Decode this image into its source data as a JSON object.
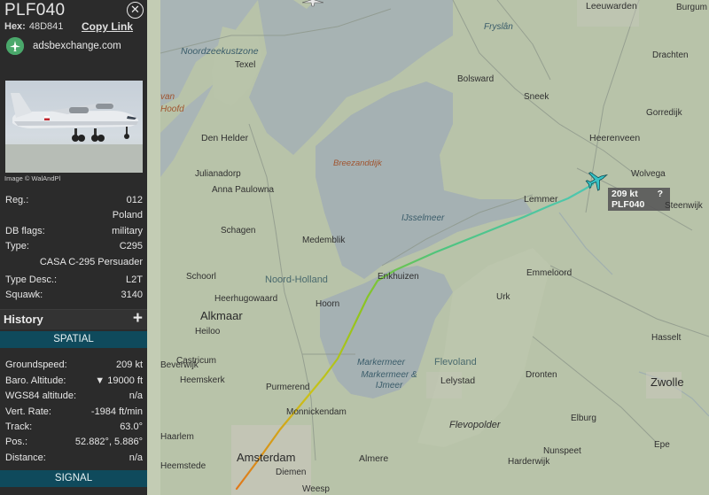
{
  "sidebar": {
    "callsign": "PLF040",
    "hex_label": "Hex:",
    "hex_value": "48D841",
    "copy_link": "Copy Link",
    "adsb_site": "adsbexchange.com",
    "photo_credit": "Image © WalAndPl",
    "info": [
      {
        "label": "Reg.:",
        "value": "012"
      },
      {
        "label": "",
        "value": "Poland"
      },
      {
        "label": "DB flags:",
        "value": "military"
      },
      {
        "label": "Type:",
        "value": "C295"
      },
      {
        "label": "",
        "value": "CASA C-295 Persuader"
      },
      {
        "label": "Type Desc.:",
        "value": "L2T"
      },
      {
        "label": "Squawk:",
        "value": "3140"
      }
    ],
    "history_title": "History",
    "history_plus": "+",
    "spatial_title": "SPATIAL",
    "spatial": [
      {
        "label": "Groundspeed:",
        "value": "209 kt"
      },
      {
        "label": "Baro. Altitude:",
        "value": "▼ 19000 ft"
      },
      {
        "label": "WGS84 altitude:",
        "value": "n/a"
      },
      {
        "label": "Vert. Rate:",
        "value": "-1984 ft/min"
      },
      {
        "label": "Track:",
        "value": "63.0°"
      },
      {
        "label": "Pos.:",
        "value": "52.882°, 5.886°"
      },
      {
        "label": "Distance:",
        "value": "n/a"
      }
    ],
    "signal_title": "SIGNAL"
  },
  "map": {
    "aircraft_speed": "209 kt",
    "aircraft_unknown": "?",
    "aircraft_callsign": "PLF040",
    "labels": {
      "leeuwarden": "Leeuwarden",
      "burgum": "Burgum",
      "fryslan": "Fryslân",
      "noordzeekustzone": "Noordzeekustzone",
      "texel": "Texel",
      "bolsward": "Bolsward",
      "drachten": "Drachten",
      "den_helder": "Den Helder",
      "sneek": "Sneek",
      "gorredijk": "Gorredijk",
      "heerenveen": "Heerenveen",
      "breezanddijk": "Breezanddijk",
      "wolvega": "Wolvega",
      "julianadorp": "Julianadorp",
      "anna_paulowna": "Anna Paulowna",
      "lemmer": "Lemmer",
      "steenwijk": "Steenwijk",
      "ijsselmeer": "IJsselmeer",
      "schagen": "Schagen",
      "medemblik": "Medemblik",
      "emmeloord": "Emmeloord",
      "schoorl": "Schoorl",
      "noord_holland": "Noord-Holland",
      "enkhuizen": "Enkhuizen",
      "heerhugowaard": "Heerhugowaard",
      "alkmaar": "Alkmaar",
      "hoorn": "Hoorn",
      "urk": "Urk",
      "heiloo": "Heiloo",
      "hasselt": "Hasselt",
      "castricum": "Castricum",
      "markermeer": "Markermeer",
      "flevoland": "Flevoland",
      "beverwijk": "Beverwijk",
      "heemskerk": "Heemskerk",
      "markermeer_ijmeer": "Markermeer & IJmeer",
      "lelystad": "Lelystad",
      "dronten": "Dronten",
      "zwolle": "Zwolle",
      "purmerend": "Purmerend",
      "monnickendam": "Monnickendam",
      "flevopolder": "Flevopolder",
      "elburg": "Elburg",
      "haarlem": "Haarlem",
      "amsterdam": "Amsterdam",
      "almere": "Almere",
      "harderwijk": "Harderwijk",
      "diemen": "Diemen",
      "nunspeet": "Nunspeet",
      "epe": "Epe",
      "heemstede": "Heemstede",
      "weesp": "Weesp",
      "bakel": "van",
      "hoofd": "Hoofd"
    },
    "colors": {
      "land": "#b8c3a9",
      "water": "#a6b3b4",
      "track_low": "#e0781a",
      "track_mid": "#9dc21e",
      "track_high": "#4ec7b4"
    }
  }
}
